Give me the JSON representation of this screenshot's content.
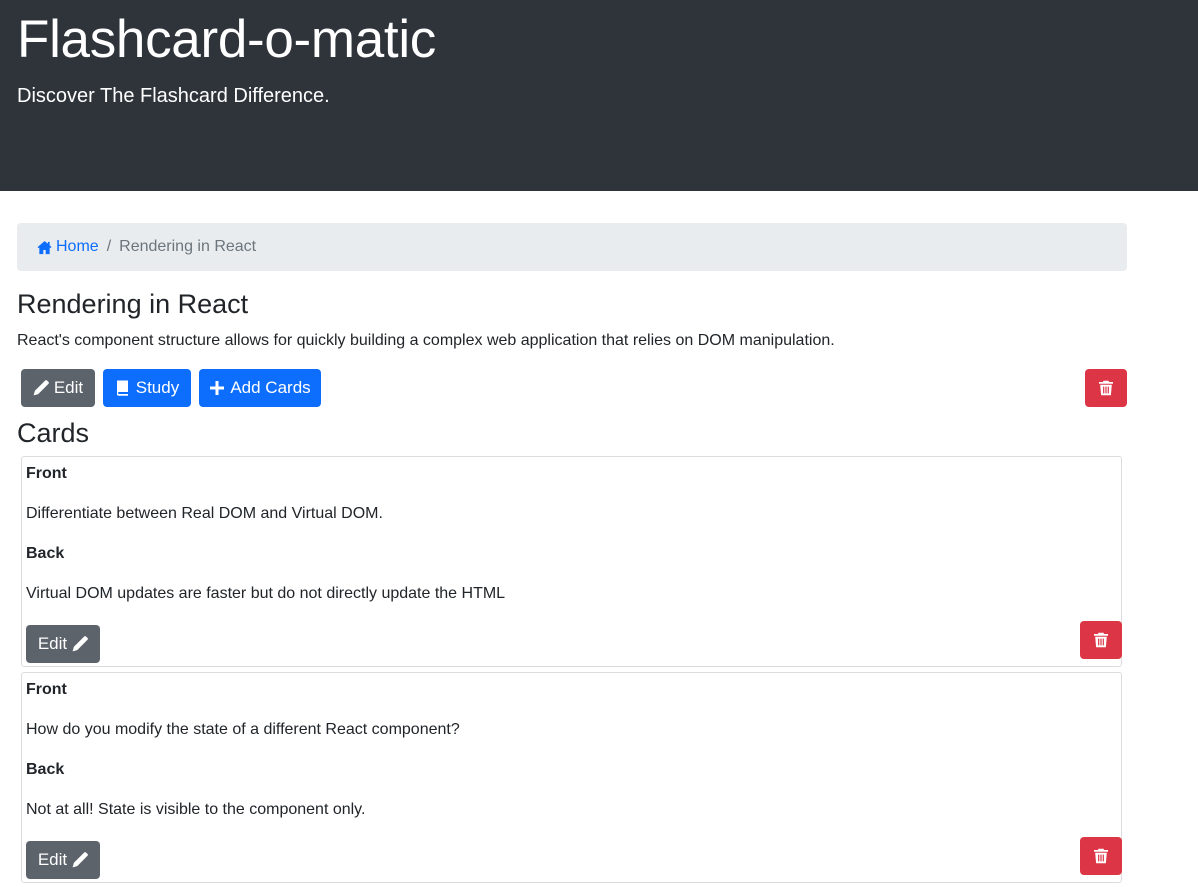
{
  "header": {
    "title": "Flashcard-o-matic",
    "subtitle": "Discover The Flashcard Difference."
  },
  "breadcrumb": {
    "home_label": "Home",
    "separator": "/",
    "current": "Rendering in React"
  },
  "deck": {
    "name": "Rendering in React",
    "description": "React's component structure allows for quickly building a complex web application that relies on DOM manipulation.",
    "actions": {
      "edit_label": "Edit",
      "study_label": "Study",
      "add_cards_label": "Add Cards"
    }
  },
  "cards_heading": "Cards",
  "cards": [
    {
      "front_label": "Front",
      "front": "Differentiate between Real DOM and Virtual DOM.",
      "back_label": "Back",
      "back": "Virtual DOM updates are faster but do not directly update the HTML",
      "edit_label": "Edit"
    },
    {
      "front_label": "Front",
      "front": "How do you modify the state of a different React component?",
      "back_label": "Back",
      "back": "Not at all! State is visible to the component only.",
      "edit_label": "Edit"
    }
  ],
  "icons": {
    "home": "house-icon",
    "edit": "pencil-icon",
    "study": "book-icon",
    "add": "plus-icon",
    "delete": "trash-icon"
  },
  "colors": {
    "header_bg": "#2f343b",
    "primary": "#0d6efd",
    "secondary": "#5c636a",
    "danger": "#dc3545",
    "breadcrumb_bg": "#e9ecef"
  }
}
